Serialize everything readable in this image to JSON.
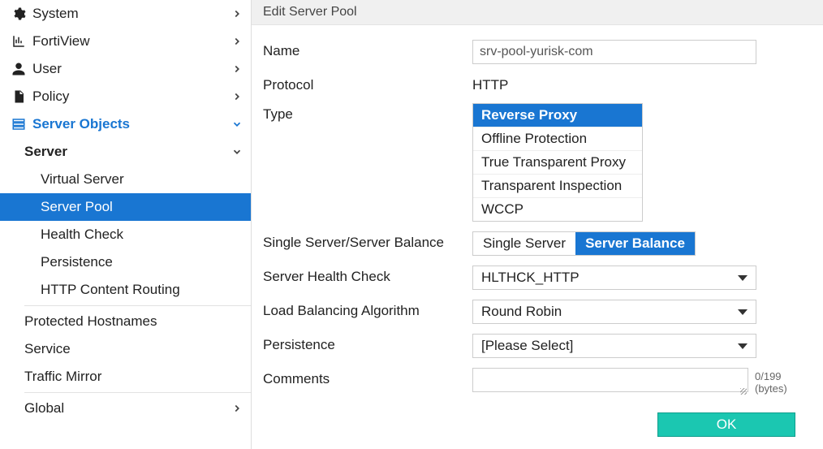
{
  "sidebar": {
    "items": [
      {
        "label": "System"
      },
      {
        "label": "FortiView"
      },
      {
        "label": "User"
      },
      {
        "label": "Policy"
      },
      {
        "label": "Server Objects"
      },
      {
        "label": "Server"
      },
      {
        "label": "Virtual Server"
      },
      {
        "label": "Server Pool"
      },
      {
        "label": "Health Check"
      },
      {
        "label": "Persistence"
      },
      {
        "label": "HTTP Content Routing"
      },
      {
        "label": "Protected Hostnames"
      },
      {
        "label": "Service"
      },
      {
        "label": "Traffic Mirror"
      },
      {
        "label": "Global"
      }
    ]
  },
  "header": {
    "title": "Edit Server Pool"
  },
  "form": {
    "name_label": "Name",
    "name_value": "srv-pool-yurisk-com",
    "protocol_label": "Protocol",
    "protocol_value": "HTTP",
    "type_label": "Type",
    "type_options": [
      "Reverse Proxy",
      "Offline Protection",
      "True Transparent Proxy",
      "Transparent Inspection",
      "WCCP"
    ],
    "balance_label": "Single Server/Server Balance",
    "balance_options": [
      "Single Server",
      "Server Balance"
    ],
    "healthcheck_label": "Server Health Check",
    "healthcheck_value": "HLTHCK_HTTP",
    "algo_label": "Load Balancing Algorithm",
    "algo_value": "Round Robin",
    "persistence_label": "Persistence",
    "persistence_value": "[Please Select]",
    "comments_label": "Comments",
    "comments_hint": "0/199 (bytes)",
    "ok_label": "OK"
  }
}
